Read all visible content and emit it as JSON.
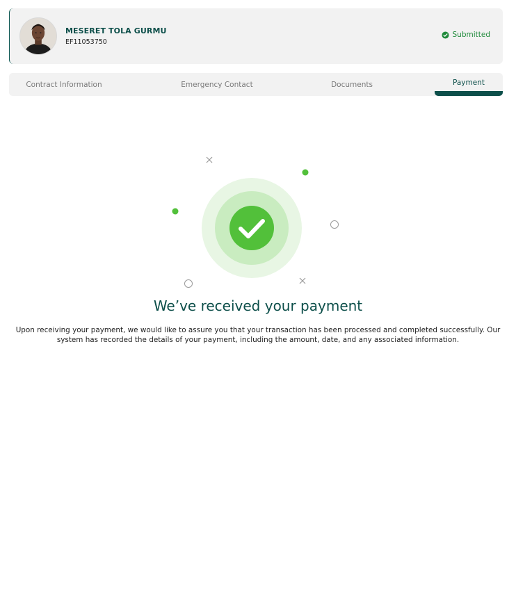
{
  "profile": {
    "name": "MESERET TOLA GURMU",
    "employee_id": "EF11053750",
    "status_label": "Submitted",
    "status_icon": "check-circle-icon"
  },
  "tabs": [
    {
      "label": "Contract Information",
      "active": false
    },
    {
      "label": "Emergency Contact",
      "active": false
    },
    {
      "label": "Documents",
      "active": false
    },
    {
      "label": "Payment",
      "active": true
    }
  ],
  "confirmation": {
    "icon": "check-circle-icon",
    "title": "We’ve received your payment",
    "description": "Upon receiving your payment, we would like to assure you that your transaction has been processed and completed successfully. Our system has recorded the details of your payment, including the amount, date, and any associated information."
  },
  "colors": {
    "brand_dark": "#0d4f4a",
    "success_green": "#52c03a",
    "status_green": "#1f8a3a",
    "panel_bg": "#f2f2f2"
  }
}
